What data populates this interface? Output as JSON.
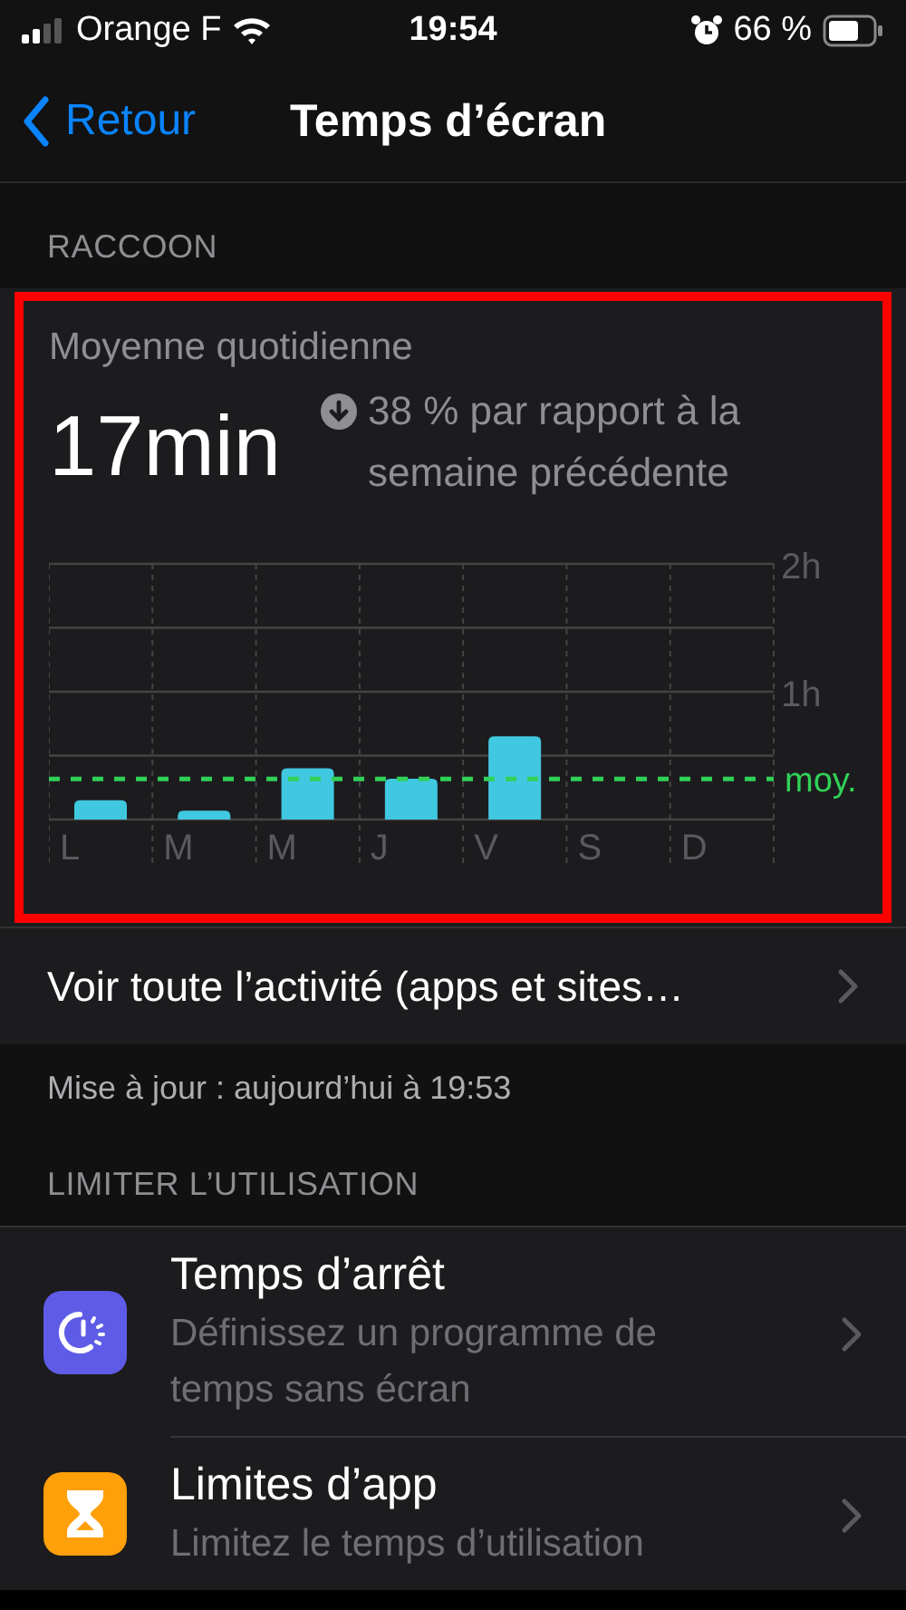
{
  "status_bar": {
    "carrier": "Orange F",
    "time": "19:54",
    "battery": "66 %"
  },
  "nav": {
    "back": "Retour",
    "title": "Temps d’écran"
  },
  "device_header": "RACCOON",
  "summary": {
    "highlighted": true,
    "title": "Moyenne quotidienne",
    "value": "17min",
    "comparison": "38 % par rapport à la semaine précédente",
    "average_label": "moy.",
    "chart_data": {
      "type": "bar",
      "categories": [
        "L",
        "M",
        "M",
        "J",
        "V",
        "S",
        "D"
      ],
      "series": [
        {
          "color": "#40c8e0",
          "values": [
            0.15,
            0.07,
            0.4,
            0.32,
            0.65,
            null,
            null
          ]
        }
      ],
      "ylim": [
        0,
        2
      ],
      "yticks": [
        {
          "value": 1,
          "label": "1h"
        },
        {
          "value": 2,
          "label": "2h"
        }
      ]
    }
  },
  "activity_link": "Voir toute l’activité (apps et sites…",
  "updated": "Mise à jour : aujourd’hui à 19:53",
  "limit_header": "LIMITER L’UTILISATION",
  "limit_items": [
    {
      "kind": "downtime",
      "title": "Temps d’arrêt",
      "subtitle": "Définissez un programme de temps sans écran",
      "color": "#5e5ce6"
    },
    {
      "kind": "applimits",
      "title": "Limites d’app",
      "subtitle": "Limitez le temps d’utilisation",
      "color": "#ff9f0a"
    }
  ]
}
